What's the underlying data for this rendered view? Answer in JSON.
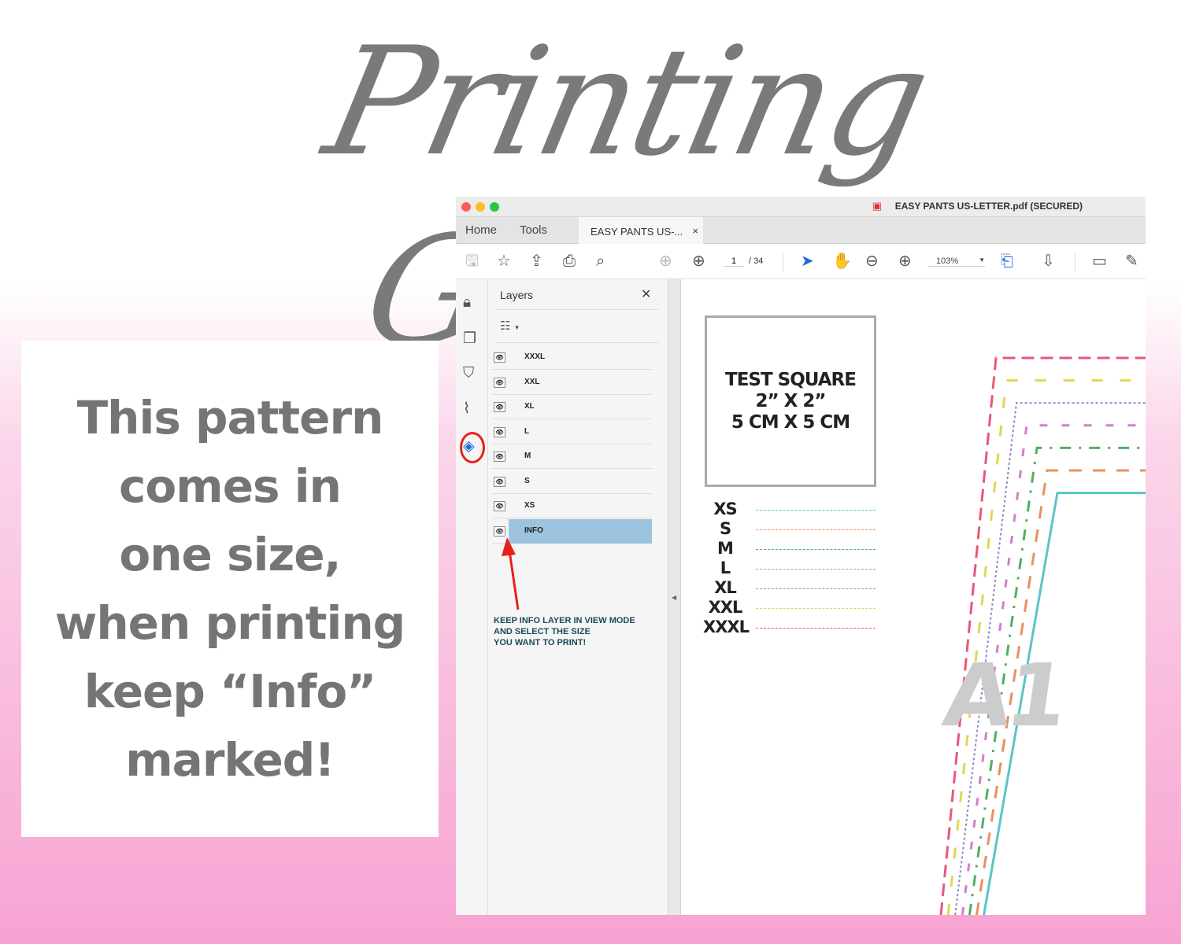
{
  "title": "Printing Guide",
  "note": [
    "This pattern",
    "comes in",
    "one size,",
    "when printing",
    "keep “Info”",
    "marked!"
  ],
  "window": {
    "title": "EASY PANTS US-LETTER.pdf (SECURED)",
    "tabs": {
      "home": "Home",
      "tools": "Tools",
      "document": "EASY PANTS US-...",
      "close": "×"
    },
    "toolbar": {
      "page_current": "1",
      "page_total": "/ 34",
      "zoom": "103%"
    },
    "layers_panel": {
      "title": "Layers",
      "close": "✕",
      "layers": [
        "XXXL",
        "XXL",
        "XL",
        "L",
        "M",
        "S",
        "XS",
        "INFO"
      ],
      "selected": "INFO",
      "annotation": [
        "KEEP INFO LAYER IN VIEW MODE",
        "AND SELECT THE SIZE",
        "YOU WANT TO PRINT!"
      ],
      "annotation_color": "#1a4a5a"
    },
    "document": {
      "test_square": [
        "TEST SQUARE",
        "2” X 2”",
        "5 CM X 5 CM"
      ],
      "sizes": [
        {
          "label": "XS",
          "color": "#5bc4c8"
        },
        {
          "label": "S",
          "color": "#e89060"
        },
        {
          "label": "M",
          "color": "#50b060"
        },
        {
          "label": "L",
          "color": "#d080c8"
        },
        {
          "label": "XL",
          "color": "#8888cc"
        },
        {
          "label": "XXL",
          "color": "#e0d850"
        },
        {
          "label": "XXXL",
          "color": "#e85878"
        }
      ],
      "piece_label": "A1"
    }
  }
}
